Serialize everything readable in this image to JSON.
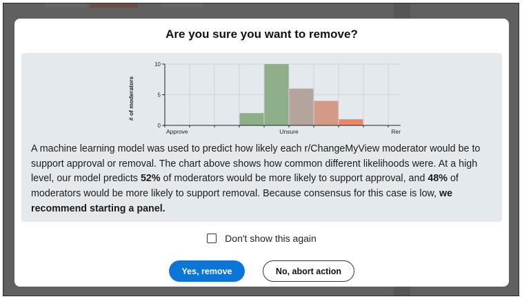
{
  "dialog": {
    "title": "Are you sure you want to remove?",
    "description": {
      "p1": "A machine learning model was used to predict how likely each r/ChangeMyView moderator would be to support approval or removal. The chart above shows how common different likelihoods were. At a high level, our model predicts ",
      "approve_pct": "52%",
      "p2": " of moderators would be more likely to support approval, and ",
      "remove_pct": "48%",
      "p3": " of moderators would be more likely to support removal. Because consensus for this case is low, ",
      "recommendation": "we recommend starting a panel."
    },
    "checkbox_label": "Don't show this again",
    "checkbox_checked": false,
    "confirm_label": "Yes, remove",
    "cancel_label": "No, abort action",
    "confirm_color": "#0b76d6"
  },
  "chart_data": {
    "type": "bar",
    "title": "",
    "ylabel": "# of moderators",
    "ylim": [
      0,
      10
    ],
    "yticks": [
      "0",
      "5",
      "10"
    ],
    "x_axis_labels": [
      "Approve",
      "Unsure",
      "Remove"
    ],
    "bins": 10,
    "values": [
      0,
      0,
      0,
      2,
      10,
      6,
      4,
      1,
      0,
      0
    ],
    "colors": [
      "#8fae8a",
      "#8fae8a",
      "#8fae8a",
      "#8fae8a",
      "#8fae8a",
      "#b5a49e",
      "#d39a88",
      "#e8866c",
      "#e8866c",
      "#e8866c"
    ],
    "grid": true
  }
}
